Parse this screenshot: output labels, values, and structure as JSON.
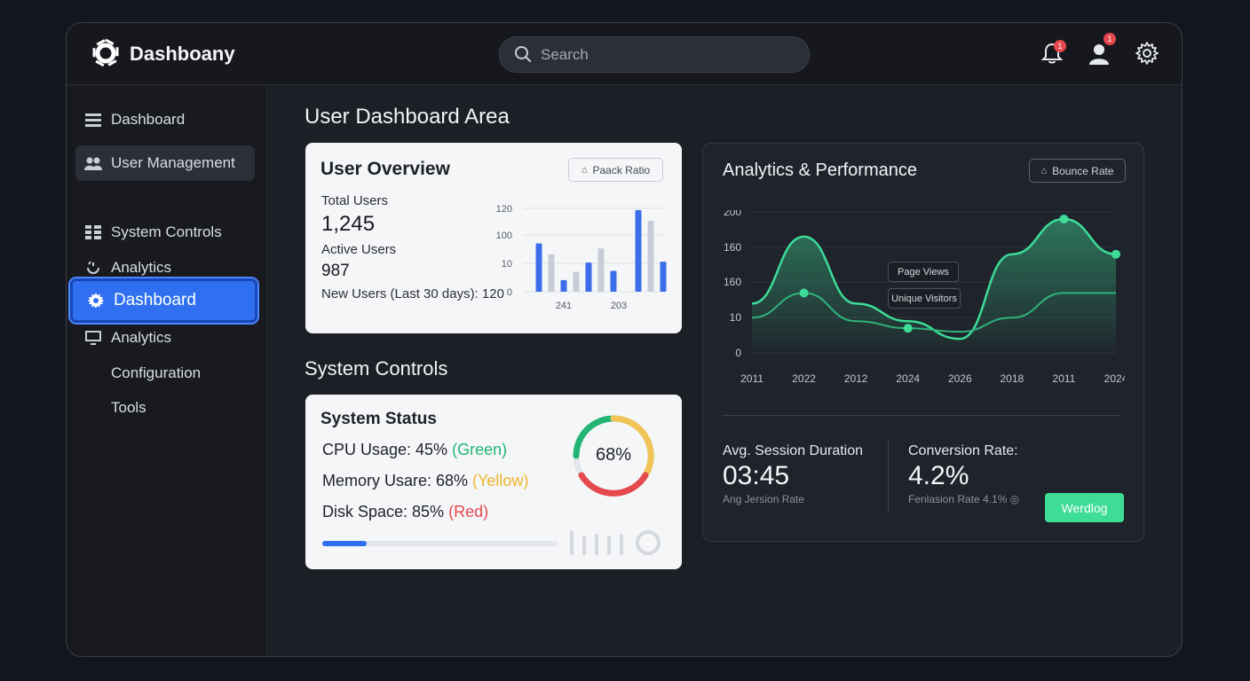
{
  "app": {
    "name": "Dashboany"
  },
  "search": {
    "placeholder": "Search"
  },
  "notifications": {
    "bell_count": "1",
    "user_count": "1"
  },
  "sidebar": {
    "items": [
      {
        "label": "Dashboard",
        "icon": "list-icon"
      },
      {
        "label": "User Management",
        "icon": "users-icon",
        "selected": true
      },
      {
        "label": "System Controls",
        "icon": "grid-icon"
      },
      {
        "label": "Analytics",
        "icon": "analytics-icon"
      },
      {
        "label": "Dashboard",
        "icon": "gear-icon",
        "active": true
      },
      {
        "label": "Analytics",
        "icon": "monitor-icon"
      },
      {
        "label": "Configuration",
        "icon": ""
      },
      {
        "label": "Tools",
        "icon": ""
      }
    ]
  },
  "main": {
    "title": "User Dashboard Area"
  },
  "user_overview": {
    "title": "User Overview",
    "button_label": "Paack Ratio",
    "total_users_label": "Total Users",
    "total_users_value": "1,245",
    "active_users_label": "Active Users",
    "active_users_value": "987",
    "new_users_text": "New Users (Last 30 days): 120",
    "chart": {
      "y_ticks": [
        "120",
        "100",
        "10",
        "0"
      ],
      "x_ticks": [
        "241",
        "203"
      ]
    }
  },
  "system_controls": {
    "section_title": "System Controls",
    "status_title": "System Status",
    "cpu_text": "CPU Usage: 45%",
    "cpu_note": "(Green)",
    "memory_text": "Memory Usare: 68%",
    "memory_note": "(Yellow)",
    "disk_text": "Disk Space: 85%",
    "disk_note": "(Red)",
    "gauge_label": "68%",
    "gauge_value": 0.68,
    "progress_value": 0.19,
    "colors": {
      "green": "#22b573",
      "yellow": "#f0b429",
      "red": "#e5484d"
    }
  },
  "analytics": {
    "title": "Analytics & Performance",
    "button_label": "Bounce Rate",
    "legend": [
      "Page Views",
      "Unique Visitors"
    ],
    "avg_session_label": "Avg. Session Duration",
    "avg_session_value": "03:45",
    "avg_session_sub": "Ang Jersion Rate",
    "conversion_label": "Conversion Rate:",
    "conversion_value": "4.2%",
    "conversion_sub": "Fenlasion Rate 4.1% ◎",
    "action_button": "Werdlog",
    "accent": "#3ddc97"
  },
  "chart_data": [
    {
      "type": "bar",
      "y_ticks": [
        "120",
        "100",
        "10",
        "0"
      ],
      "x_tick_labels": [
        "241",
        "203"
      ],
      "series": [
        {
          "values": [
            58,
            0,
            14,
            0,
            35,
            0,
            25,
            0,
            98,
            0,
            36
          ]
        },
        {
          "values": [
            0,
            45,
            0,
            24,
            0,
            52,
            0,
            0,
            0,
            85,
            0
          ]
        }
      ],
      "colors": {
        "primary": "#3b6ee8",
        "secondary": "#c8ccd6"
      }
    },
    {
      "type": "area",
      "x": [
        "2011",
        "2022",
        "2012",
        "2024",
        "2026",
        "2018",
        "2011",
        "2024"
      ],
      "y_ticks": [
        "200",
        "160",
        "160",
        "10",
        "0"
      ],
      "series": [
        {
          "name": "Page Views",
          "values": [
            70,
            165,
            70,
            45,
            20,
            140,
            190,
            140
          ]
        },
        {
          "name": "Unique Visitors",
          "values": [
            50,
            85,
            45,
            35,
            30,
            50,
            85,
            85
          ]
        }
      ]
    }
  ]
}
